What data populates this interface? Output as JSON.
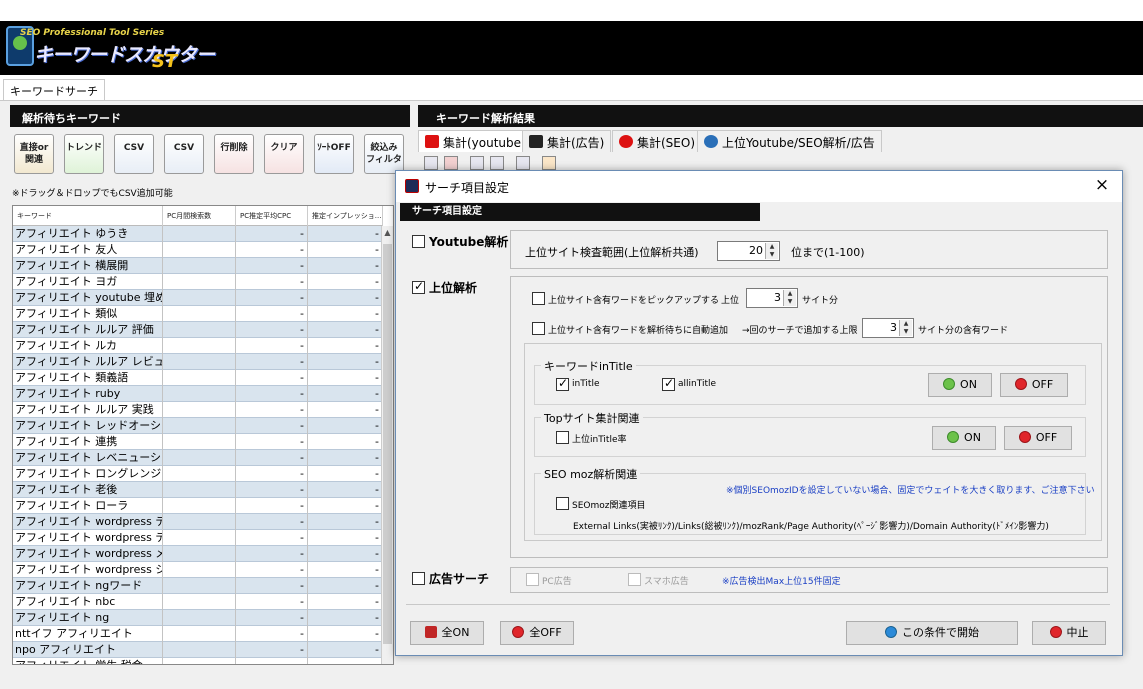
{
  "header": {
    "brand_small": "SEO Professional Tool Series",
    "brand_main": "キーワードスカウター",
    "brand_suffix": "ST"
  },
  "top_tab": "キーワードサーチ",
  "left_panel": {
    "title": "解析待ちキーワード",
    "tools": [
      {
        "label": "直接or\n関連",
        "icon": "direct-related-icon"
      },
      {
        "label": "トレンド",
        "icon": "trend-icon"
      },
      {
        "label": "CSV",
        "icon": "csv-import-icon"
      },
      {
        "label": "CSV",
        "icon": "csv-export-icon"
      },
      {
        "label": "行削除",
        "icon": "row-delete-icon"
      },
      {
        "label": "クリア",
        "icon": "clear-icon"
      },
      {
        "label": "ｿｰﾄOFF",
        "icon": "sort-off-icon"
      },
      {
        "label": "絞込み\nフィルタ",
        "icon": "filter-icon"
      }
    ],
    "hint": "※ドラッグ＆ドロップでもCSV追加可能",
    "columns": [
      "キーワード",
      "PC月間検索数",
      "PC推定平均CPC",
      "推定インプレッショ..."
    ],
    "rows": [
      {
        "keyword": "アフィリエイト ゆうき",
        "cpc": "-",
        "imp": "-"
      },
      {
        "keyword": "アフィリエイト 友人",
        "cpc": "-",
        "imp": "-"
      },
      {
        "keyword": "アフィリエイト 横展開",
        "cpc": "-",
        "imp": "-"
      },
      {
        "keyword": "アフィリエイト ヨガ",
        "cpc": "-",
        "imp": "-"
      },
      {
        "keyword": "アフィリエイト youtube 埋め込...",
        "cpc": "-",
        "imp": "-"
      },
      {
        "keyword": "アフィリエイト 類似",
        "cpc": "-",
        "imp": "-"
      },
      {
        "keyword": "アフィリエイト ルルア 評価",
        "cpc": "-",
        "imp": "-"
      },
      {
        "keyword": "アフィリエイト ルカ",
        "cpc": "-",
        "imp": "-"
      },
      {
        "keyword": "アフィリエイト ルルア レビュー",
        "cpc": "-",
        "imp": "-"
      },
      {
        "keyword": "アフィリエイト 類義語",
        "cpc": "-",
        "imp": "-"
      },
      {
        "keyword": "アフィリエイト ruby",
        "cpc": "-",
        "imp": "-"
      },
      {
        "keyword": "アフィリエイト ルルア 実践",
        "cpc": "-",
        "imp": "-"
      },
      {
        "keyword": "アフィリエイト レッドオーシャン",
        "cpc": "-",
        "imp": "-"
      },
      {
        "keyword": "アフィリエイト 連携",
        "cpc": "-",
        "imp": "-"
      },
      {
        "keyword": "アフィリエイト レベニューシェア",
        "cpc": "-",
        "imp": "-"
      },
      {
        "keyword": "アフィリエイト ロングレンジ",
        "cpc": "-",
        "imp": "-"
      },
      {
        "keyword": "アフィリエイト 老後",
        "cpc": "-",
        "imp": "-"
      },
      {
        "keyword": "アフィリエイト ローラ",
        "cpc": "-",
        "imp": "-"
      },
      {
        "keyword": "アフィリエイト wordpress テー...",
        "cpc": "-",
        "imp": "-"
      },
      {
        "keyword": "アフィリエイト wordpress テー...",
        "cpc": "-",
        "imp": "-"
      },
      {
        "keyword": "アフィリエイト wordpress メリット",
        "cpc": "-",
        "imp": "-"
      },
      {
        "keyword": "アフィリエイト wordpress シリ...",
        "cpc": "-",
        "imp": "-"
      },
      {
        "keyword": "アフィリエイト ngワード",
        "cpc": "-",
        "imp": "-"
      },
      {
        "keyword": "アフィリエイト nbc",
        "cpc": "-",
        "imp": "-"
      },
      {
        "keyword": "アフィリエイト ng",
        "cpc": "-",
        "imp": "-"
      },
      {
        "keyword": "nttイフ アフィリエイト",
        "cpc": "-",
        "imp": "-"
      },
      {
        "keyword": "npo アフィリエイト",
        "cpc": "-",
        "imp": "-"
      },
      {
        "keyword": "アフィリエイト 学生 税金",
        "cpc": "-",
        "imp": "-"
      }
    ]
  },
  "right_panel": {
    "title": "キーワード解析結果",
    "tabs": [
      {
        "label": "集計(youtube)",
        "icon": "youtube-icon",
        "color": "#d11"
      },
      {
        "label": "集計(広告)",
        "icon": "ad-icon",
        "color": "#222"
      },
      {
        "label": "集計(SEO)",
        "icon": "seo-icon",
        "color": "#d11"
      },
      {
        "label": "上位Youtube/SEO解析/広告",
        "icon": "globe-icon",
        "color": "#2a6fb8"
      }
    ]
  },
  "dialog": {
    "title": "サーチ項目設定",
    "section": "サーチ項目設定",
    "close": "×",
    "youtube": {
      "label": "Youtube解析",
      "checked": false,
      "range_label": "上位サイト検査範囲(上位解析共通)",
      "range_value": "20",
      "range_suffix": "位まで(1-100)"
    },
    "top": {
      "label": "上位解析",
      "checked": true,
      "pickup_label": "上位サイト含有ワードをピックアップする",
      "pickup_prefix": "上位",
      "pickup_value": "3",
      "pickup_suffix": "サイト分",
      "auto_label": "上位サイト含有ワードを解析待ちに自動追加",
      "auto_limit_label": "→回のサーチで追加する上限",
      "auto_value": "3",
      "auto_suffix": "サイト分の含有ワード",
      "kw_group": {
        "title": "キーワードinTitle",
        "intitle": "inTitle",
        "allintitle": "allinTitle",
        "on": "ON",
        "off": "OFF"
      },
      "topsite_group": {
        "title": "Topサイト集計関連",
        "rate": "上位inTitle率",
        "on": "ON",
        "off": "OFF"
      },
      "moz_group": {
        "title": "SEO moz解析関連",
        "note": "※個別SEOmozIDを設定していない場合、固定でウェイトを大きく取ります、ご注意下さい",
        "item": "SEOmoz関連項目",
        "desc": "External Links(実被ﾘﾝｸ)/Links(総被ﾘﾝｸ)/mozRank/Page Authority(ﾍﾟｰｼﾞ影響力)/Domain Authority(ﾄﾞﾒｲﾝ影響力)"
      }
    },
    "ads": {
      "label": "広告サーチ",
      "checked": false,
      "pc": "PC広告",
      "sp": "スマホ広告",
      "note": "※広告検出Max上位15件固定"
    },
    "footer": {
      "all_on": "全ON",
      "all_off": "全OFF",
      "start": "この条件で開始",
      "cancel": "中止"
    }
  }
}
